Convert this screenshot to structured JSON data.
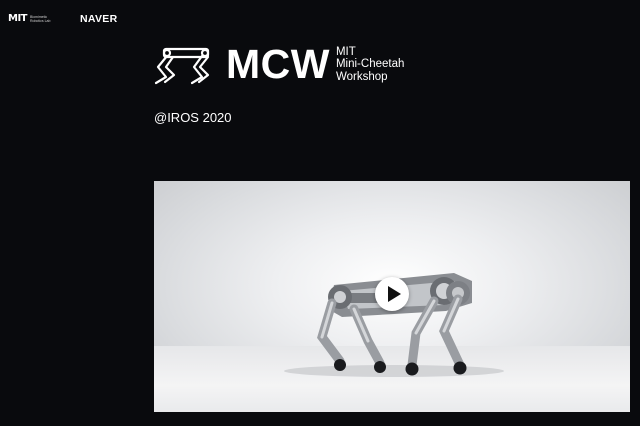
{
  "header": {
    "mit_mark": "MIT",
    "mit_lab": "Biomimetic Robotics Lab",
    "partner": "NAVER"
  },
  "brand": {
    "acronym": "MCW",
    "line1": "MIT",
    "line2": "Mini-Cheetah",
    "line3": "Workshop"
  },
  "event": {
    "venue": "@IROS 2020"
  },
  "video": {
    "play_icon": "play-icon"
  },
  "colors": {
    "background": "#090a0d",
    "text": "#ffffff"
  }
}
